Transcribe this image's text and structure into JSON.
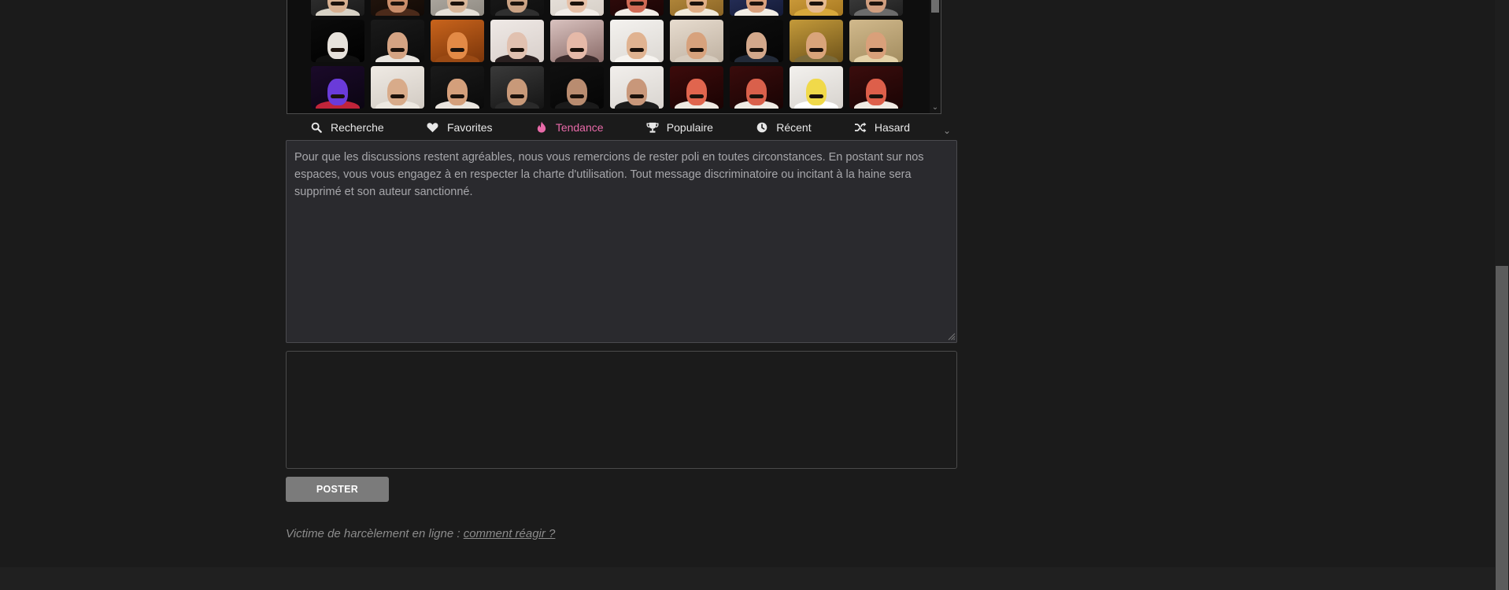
{
  "stickers": {
    "items": [
      {
        "name": "sticker-risitas-1",
        "c1": "#3a3a3a",
        "c2": "#1a1a1a",
        "skin": "#d7b091",
        "shirt": "#d8d2c6"
      },
      {
        "name": "sticker-risitas-2",
        "c1": "#2a1a10",
        "c2": "#120a06",
        "skin": "#c98d6a",
        "shirt": "#4b2a1a"
      },
      {
        "name": "sticker-risitas-3",
        "c1": "#bdb8b0",
        "c2": "#8f8a82",
        "skin": "#d9b79a",
        "shirt": "#e5e0d8"
      },
      {
        "name": "sticker-risitas-4",
        "c1": "#1d1d1d",
        "c2": "#0f0f0f",
        "skin": "#caa284",
        "shirt": "#2f2f2f"
      },
      {
        "name": "sticker-risitas-5",
        "c1": "#efeae4",
        "c2": "#d6cfc7",
        "skin": "#e7c1a8",
        "shirt": "#f2ede8"
      },
      {
        "name": "sticker-risitas-6",
        "c1": "#3b0d0d",
        "c2": "#1a0505",
        "skin": "#d06a55",
        "shirt": "#f1ece6"
      },
      {
        "name": "sticker-risitas-7",
        "c1": "#c99c47",
        "c2": "#8a6425",
        "skin": "#e0ae85",
        "shirt": "#f0e9d9"
      },
      {
        "name": "sticker-risitas-8",
        "c1": "#2f3a6b",
        "c2": "#141a36",
        "skin": "#d9a07c",
        "shirt": "#f2ede5"
      },
      {
        "name": "sticker-risitas-9",
        "c1": "#e2b04a",
        "c2": "#a77820",
        "skin": "#e5b98f",
        "shirt": "#d8a83b"
      },
      {
        "name": "sticker-risitas-10",
        "c1": "#4a4a4a",
        "c2": "#1f1f1f",
        "skin": "#cf9d7e",
        "shirt": "#6b6b6b"
      },
      {
        "name": "sticker-risitas-11",
        "c1": "#0b0b0b",
        "c2": "#000000",
        "skin": "#e7e2dc",
        "shirt": "#101010"
      },
      {
        "name": "sticker-risitas-12",
        "c1": "#1a1a1a",
        "c2": "#0b0b0b",
        "skin": "#d4a383",
        "shirt": "#e9e5e0"
      },
      {
        "name": "sticker-risitas-13",
        "c1": "#c9641c",
        "c2": "#7a350a",
        "skin": "#e38a46",
        "shirt": "#9b4a14"
      },
      {
        "name": "sticker-risitas-14",
        "c1": "#efe9e6",
        "c2": "#d8cfca",
        "skin": "#e1c1b0",
        "shirt": "#2a2020"
      },
      {
        "name": "sticker-risitas-15",
        "c1": "#d9c2bf",
        "c2": "#8a6b68",
        "skin": "#e5b9a8",
        "shirt": "#3a2a2a"
      },
      {
        "name": "sticker-risitas-16",
        "c1": "#f4f2ef",
        "c2": "#dcd8d3",
        "skin": "#e0b391",
        "shirt": "#f6f3ef"
      },
      {
        "name": "sticker-risitas-17",
        "c1": "#e7dccf",
        "c2": "#bfb1a1",
        "skin": "#d7a27d",
        "shirt": "#d6cbbd"
      },
      {
        "name": "sticker-risitas-18",
        "c1": "#0d0d0d",
        "c2": "#050505",
        "skin": "#d3a88b",
        "shirt": "#222a38"
      },
      {
        "name": "sticker-risitas-19",
        "c1": "#c49a3a",
        "c2": "#6e531a",
        "skin": "#d9a47a",
        "shirt": "#7a6a3a"
      },
      {
        "name": "sticker-risitas-20",
        "c1": "#d1b98c",
        "c2": "#a38d60",
        "skin": "#d9a07a",
        "shirt": "#e4d2a8"
      },
      {
        "name": "sticker-risitas-21",
        "c1": "#1b0a2a",
        "c2": "#0b0512",
        "skin": "#6a3bd9",
        "shirt": "#c0243a"
      },
      {
        "name": "sticker-risitas-22",
        "c1": "#efeae4",
        "c2": "#d2cbc3",
        "skin": "#d8ab8a",
        "shirt": "#ede8e1"
      },
      {
        "name": "sticker-risitas-23",
        "c1": "#1a1a1a",
        "c2": "#0a0a0a",
        "skin": "#d49f7b",
        "shirt": "#eae5df"
      },
      {
        "name": "sticker-risitas-24",
        "c1": "#3a3a3a",
        "c2": "#151515",
        "skin": "#c89979",
        "shirt": "#2a2a2a"
      },
      {
        "name": "sticker-risitas-25",
        "c1": "#101010",
        "c2": "#050505",
        "skin": "#b98c70",
        "shirt": "#1a1a1a"
      },
      {
        "name": "sticker-risitas-26",
        "c1": "#f2efec",
        "c2": "#d9d5d0",
        "skin": "#c8977a",
        "shirt": "#1c1c1c"
      },
      {
        "name": "sticker-risitas-27",
        "c1": "#3d0b0b",
        "c2": "#1a0303",
        "skin": "#e0654e",
        "shirt": "#efe9e2"
      },
      {
        "name": "sticker-risitas-28",
        "c1": "#3a0c0c",
        "c2": "#190404",
        "skin": "#d9604b",
        "shirt": "#efeae4"
      },
      {
        "name": "sticker-risitas-29",
        "c1": "#f3f1ee",
        "c2": "#d7d3ce",
        "skin": "#f0d94a",
        "shirt": "#ffffff"
      },
      {
        "name": "sticker-risitas-30",
        "c1": "#3b0d0d",
        "c2": "#1a0404",
        "skin": "#dd5f4a",
        "shirt": "#f0eae3"
      }
    ]
  },
  "tabs": [
    {
      "label": "Recherche",
      "icon": "search-icon",
      "name": "tab-recherche",
      "active": false
    },
    {
      "label": "Favorites",
      "icon": "heart-icon",
      "name": "tab-favorites",
      "active": false
    },
    {
      "label": "Tendance",
      "icon": "flame-icon",
      "name": "tab-tendance",
      "active": true
    },
    {
      "label": "Populaire",
      "icon": "trophy-icon",
      "name": "tab-populaire",
      "active": false
    },
    {
      "label": "Récent",
      "icon": "clock-icon",
      "name": "tab-recent",
      "active": false
    },
    {
      "label": "Hasard",
      "icon": "shuffle-icon",
      "name": "tab-hasard",
      "active": false
    }
  ],
  "colors": {
    "background": "#1b1b1b",
    "active_tab": "#e86aa8",
    "post_button": "#7b7b7b",
    "textarea_bg": "#2a2a2e"
  },
  "reply": {
    "placeholder": "Pour que les discussions restent agréables, nous vous remercions de rester poli en toutes circonstances. En postant sur nos espaces, vous vous engagez à en respecter la charte d'utilisation. Tout message discriminatoire ou incitant à la haine sera supprimé et son auteur sanctionné."
  },
  "post_button_label": "POSTER",
  "harassment": {
    "text": "Victime de harcèlement en ligne : ",
    "link": "comment réagir ?"
  }
}
